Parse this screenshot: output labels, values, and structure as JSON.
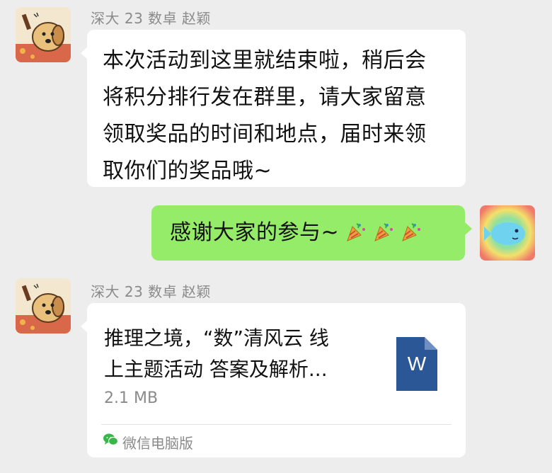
{
  "messages": [
    {
      "sender": "深大 23 数卓 赵颖",
      "lines": [
        "本次活动到这里就结束啦，稍后会",
        "将积分排行发在群里，请大家留意",
        "领取奖品的时间和地点，届时来领",
        "取你们的奖品哦~"
      ]
    },
    {
      "text": "感谢大家的参与~"
    },
    {
      "sender": "深大 23 数卓 赵颖",
      "file": {
        "title_lines": [
          "推理之境，“数”清风云 线",
          "上主题活动 答案及解析..."
        ],
        "size": "2.1 MB",
        "icon_letter": "W",
        "source": "微信电脑版"
      }
    }
  ],
  "colors": {
    "background": "#ededed",
    "incoming_bubble": "#ffffff",
    "outgoing_bubble": "#95ec69",
    "word_icon": "#2b5797"
  }
}
